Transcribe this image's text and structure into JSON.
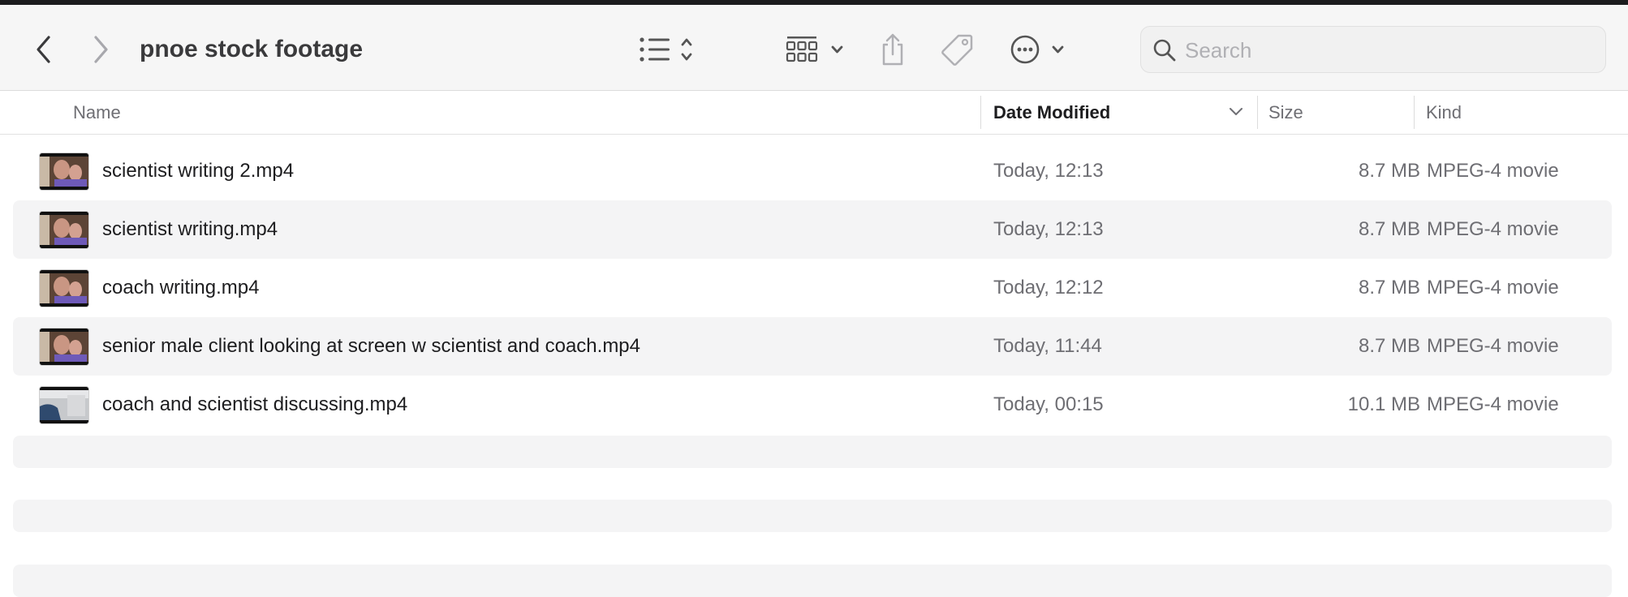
{
  "window": {
    "title": "pnoe stock footage"
  },
  "toolbar": {
    "back_icon": "chevron-left-icon",
    "forward_icon": "chevron-right-icon",
    "view_list_icon": "list-view-icon",
    "group_icon": "grid-group-icon",
    "share_icon": "share-icon",
    "tag_icon": "tag-icon",
    "more_icon": "ellipsis-circle-icon"
  },
  "search": {
    "placeholder": "Search",
    "value": ""
  },
  "columns": {
    "name": "Name",
    "date": "Date Modified",
    "size": "Size",
    "kind": "Kind",
    "sorted_by": "Date Modified"
  },
  "files": [
    {
      "name": "scientist writing 2.mp4",
      "date": "Today, 12:13",
      "size": "8.7 MB",
      "kind": "MPEG-4 movie",
      "thumb": "person"
    },
    {
      "name": "scientist writing.mp4",
      "date": "Today, 12:13",
      "size": "8.7 MB",
      "kind": "MPEG-4 movie",
      "thumb": "person"
    },
    {
      "name": "coach writing.mp4",
      "date": "Today, 12:12",
      "size": "8.7 MB",
      "kind": "MPEG-4 movie",
      "thumb": "person"
    },
    {
      "name": "senior male client looking at screen w scientist and coach.mp4",
      "date": "Today, 11:44",
      "size": "8.7 MB",
      "kind": "MPEG-4 movie",
      "thumb": "person"
    },
    {
      "name": "coach and scientist discussing.mp4",
      "date": "Today, 00:15",
      "size": "10.1 MB",
      "kind": "MPEG-4 movie",
      "thumb": "room"
    }
  ],
  "colors": {
    "toolbar_bg": "#f6f6f6",
    "alt_row": "#f4f4f5",
    "secondary_text": "#6e6e73"
  }
}
